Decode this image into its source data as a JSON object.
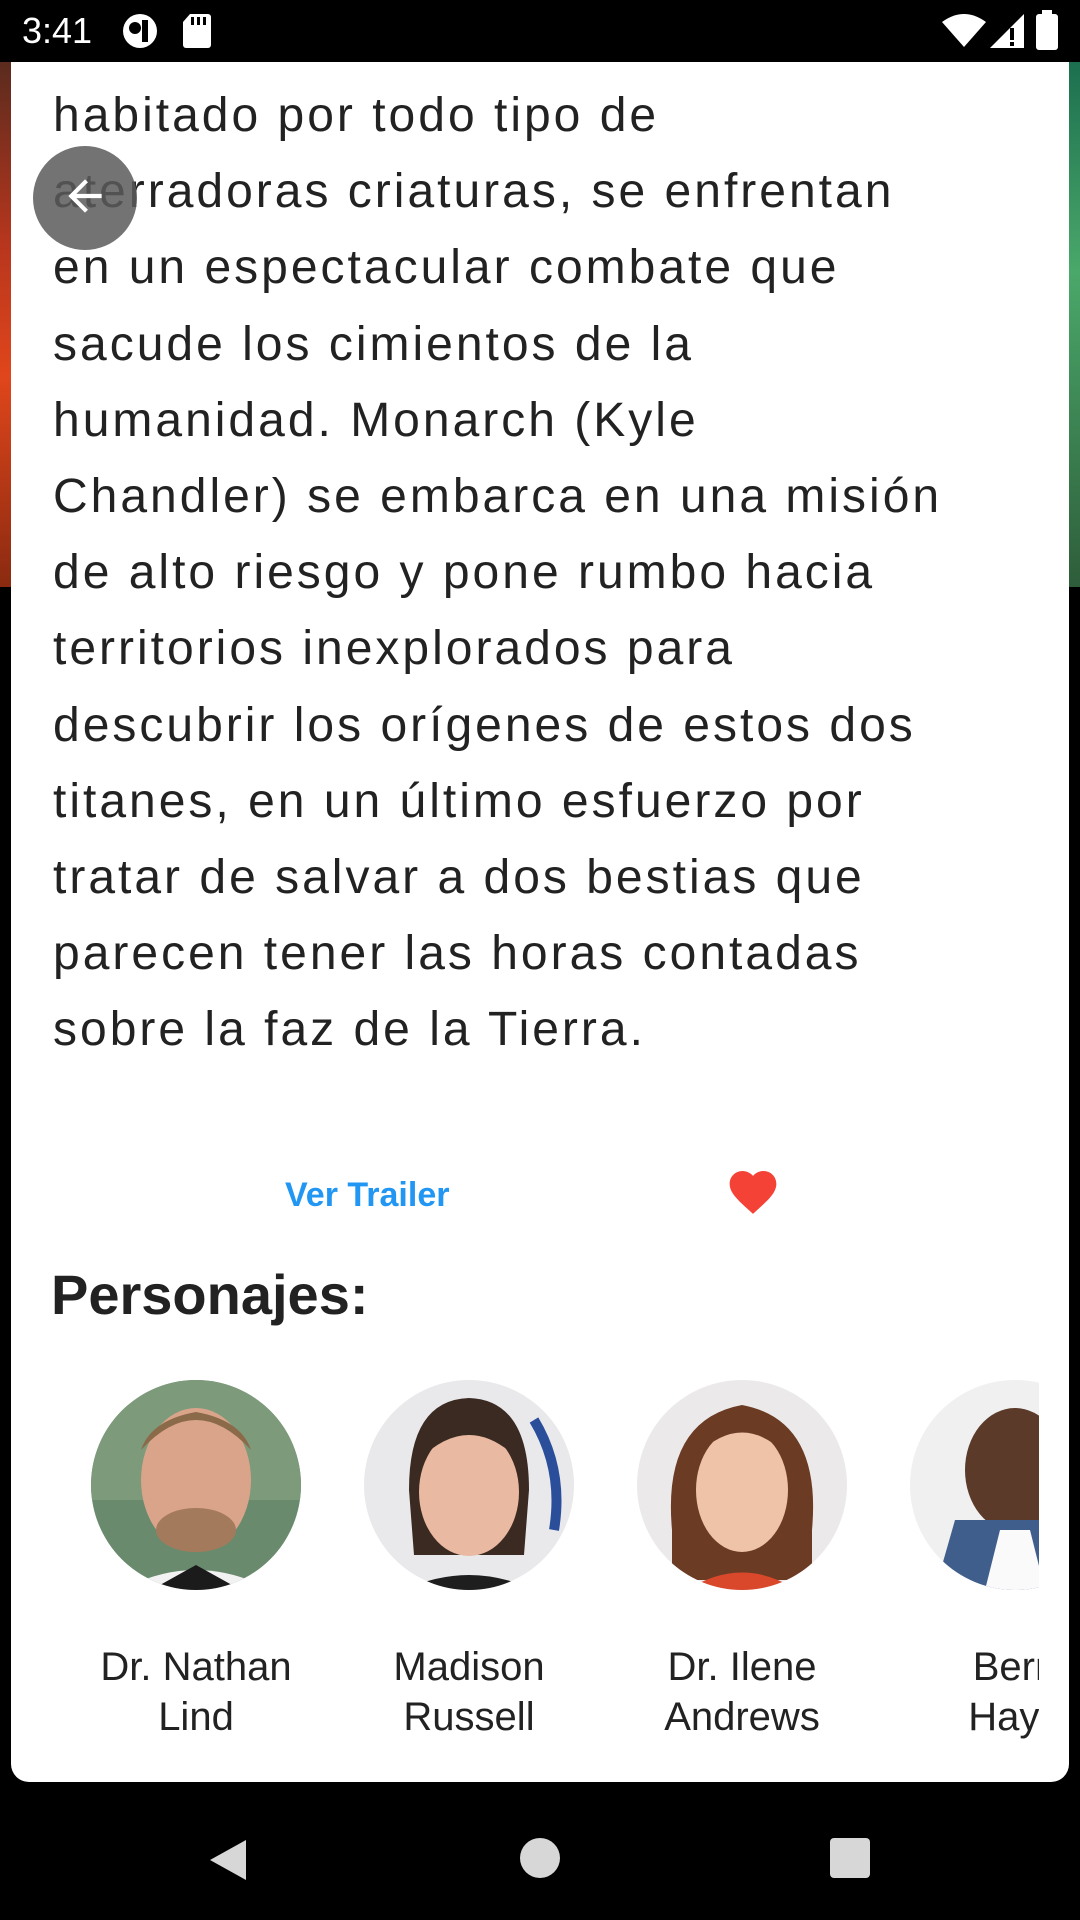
{
  "status_bar": {
    "time": "3:41",
    "icons": [
      "app-notification-icon",
      "sd-card-icon",
      "wifi-icon",
      "signal-icon",
      "battery-icon"
    ]
  },
  "synopsis_lines": [
    "habitado por todo tipo de",
    "aterradoras criaturas, se enfrentan",
    "en un espectacular combate que",
    "sacude los cimientos de la",
    "humanidad. Monarch (Kyle",
    "Chandler) se embarca en una misión",
    "de alto riesgo y pone rumbo hacia",
    "territorios inexplorados para",
    "descubrir los orígenes de estos dos",
    "titanes, en un último esfuerzo por",
    "tratar de salvar a dos bestias que",
    "parecen tener las horas contadas",
    "sobre la faz de la Tierra."
  ],
  "actions": {
    "trailer_label": "Ver Trailer",
    "favorite_icon": "heart-icon",
    "favorite_color": "#F44336",
    "link_color": "#2196F3"
  },
  "cast_section": {
    "title": "Personajes:",
    "characters": [
      {
        "line1": "Dr. Nathan",
        "line2": "Lind"
      },
      {
        "line1": "Madison",
        "line2": "Russell"
      },
      {
        "line1": "Dr. Ilene",
        "line2": "Andrews"
      },
      {
        "line1": "Bern",
        "line2": "Haye"
      }
    ]
  },
  "nav_bar": {
    "icons": [
      "nav-back-icon",
      "nav-home-icon",
      "nav-recents-icon"
    ]
  }
}
